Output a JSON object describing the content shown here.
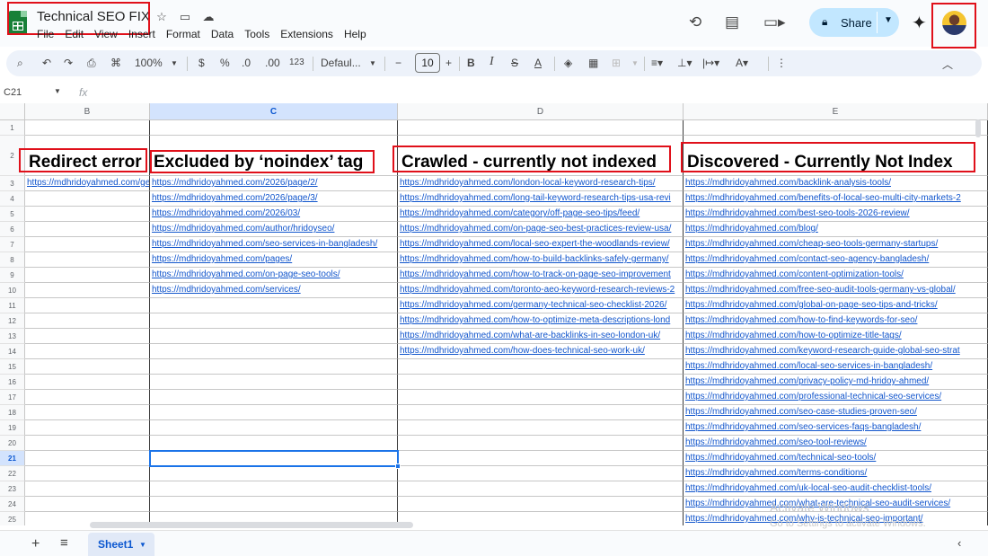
{
  "app": {
    "doc_title": "Technical SEO FIX",
    "menu": [
      "File",
      "Edit",
      "View",
      "Insert",
      "Format",
      "Data",
      "Tools",
      "Extensions",
      "Help"
    ],
    "share_label": "Share"
  },
  "toolbar": {
    "zoom": "100%",
    "currency": "$",
    "percent": "%",
    "dec_decrease": ".0",
    "dec_increase": ".00",
    "number_format": "123",
    "font": "Defaul...",
    "font_size": "10"
  },
  "formula_bar": {
    "cell_ref": "C21",
    "fx": "fx"
  },
  "columns": [
    "B",
    "C",
    "D",
    "E"
  ],
  "active_column": "C",
  "active_row": 21,
  "rows": [
    1,
    2,
    3,
    4,
    5,
    6,
    7,
    8,
    9,
    10,
    11,
    12,
    13,
    14,
    15,
    16,
    17,
    18,
    19,
    20,
    21,
    22,
    23,
    24,
    25
  ],
  "headers": {
    "B": "Redirect error",
    "C": "Excluded by ‘noindex’ tag",
    "D": "Crawled - currently not indexed",
    "E": "Discovered - Currently Not Index"
  },
  "col_b": [
    "https://mdhridoyahmed.com/get"
  ],
  "col_c": [
    "https://mdhridoyahmed.com/2026/page/2/",
    "https://mdhridoyahmed.com/2026/page/3/",
    "https://mdhridoyahmed.com/2026/03/",
    "https://mdhridoyahmed.com/author/hridoyseo/",
    "https://mdhridoyahmed.com/seo-services-in-bangladesh/",
    "https://mdhridoyahmed.com/pages/",
    "https://mdhridoyahmed.com/on-page-seo-tools/",
    "https://mdhridoyahmed.com/services/"
  ],
  "col_d": [
    "https://mdhridoyahmed.com/london-local-keyword-research-tips/",
    "https://mdhridoyahmed.com/long-tail-keyword-research-tips-usa-revi",
    "https://mdhridoyahmed.com/category/off-page-seo-tips/feed/",
    "https://mdhridoyahmed.com/on-page-seo-best-practices-review-usa/",
    "https://mdhridoyahmed.com/local-seo-expert-the-woodlands-review/",
    "https://mdhridoyahmed.com/how-to-build-backlinks-safely-germany/",
    "https://mdhridoyahmed.com/how-to-track-on-page-seo-improvement",
    "https://mdhridoyahmed.com/toronto-aeo-keyword-research-reviews-2",
    "https://mdhridoyahmed.com/germany-technical-seo-checklist-2026/",
    "https://mdhridoyahmed.com/how-to-optimize-meta-descriptions-lond",
    "https://mdhridoyahmed.com/what-are-backlinks-in-seo-london-uk/",
    "https://mdhridoyahmed.com/how-does-technical-seo-work-uk/"
  ],
  "col_e": [
    "https://mdhridoyahmed.com/backlink-analysis-tools/",
    "https://mdhridoyahmed.com/benefits-of-local-seo-multi-city-markets-2",
    "https://mdhridoyahmed.com/best-seo-tools-2026-review/",
    "https://mdhridoyahmed.com/blog/",
    "https://mdhridoyahmed.com/cheap-seo-tools-germany-startups/",
    "https://mdhridoyahmed.com/contact-seo-agency-bangladesh/",
    "https://mdhridoyahmed.com/content-optimization-tools/",
    "https://mdhridoyahmed.com/free-seo-audit-tools-germany-vs-global/",
    "https://mdhridoyahmed.com/global-on-page-seo-tips-and-tricks/",
    "https://mdhridoyahmed.com/how-to-find-keywords-for-seo/",
    "https://mdhridoyahmed.com/how-to-optimize-title-tags/",
    "https://mdhridoyahmed.com/keyword-research-guide-global-seo-strat",
    "https://mdhridoyahmed.com/local-seo-services-in-bangladesh/",
    "https://mdhridoyahmed.com/privacy-policy-md-hridoy-ahmed/",
    "https://mdhridoyahmed.com/professional-technical-seo-services/",
    "https://mdhridoyahmed.com/seo-case-studies-proven-seo/",
    "https://mdhridoyahmed.com/seo-services-faqs-bangladesh/",
    "https://mdhridoyahmed.com/seo-tool-reviews/",
    "https://mdhridoyahmed.com/technical-seo-tools/",
    "https://mdhridoyahmed.com/terms-conditions/",
    "https://mdhridoyahmed.com/uk-local-seo-audit-checklist-tools/",
    "https://mdhridoyahmed.com/what-are-technical-seo-audit-services/",
    "https://mdhridoyahmed.com/why-is-technical-seo-important/"
  ],
  "watermark": {
    "line1": "Activate Windows",
    "line2": "Go to Settings to activate Windows."
  },
  "sheet_tab": "Sheet1",
  "colors": {
    "annotation_red": "#e0101a",
    "link_blue": "#1155cc",
    "sheets_green": "#188038",
    "share_bg": "#c2e7ff",
    "selection_blue": "#1a73e8"
  }
}
